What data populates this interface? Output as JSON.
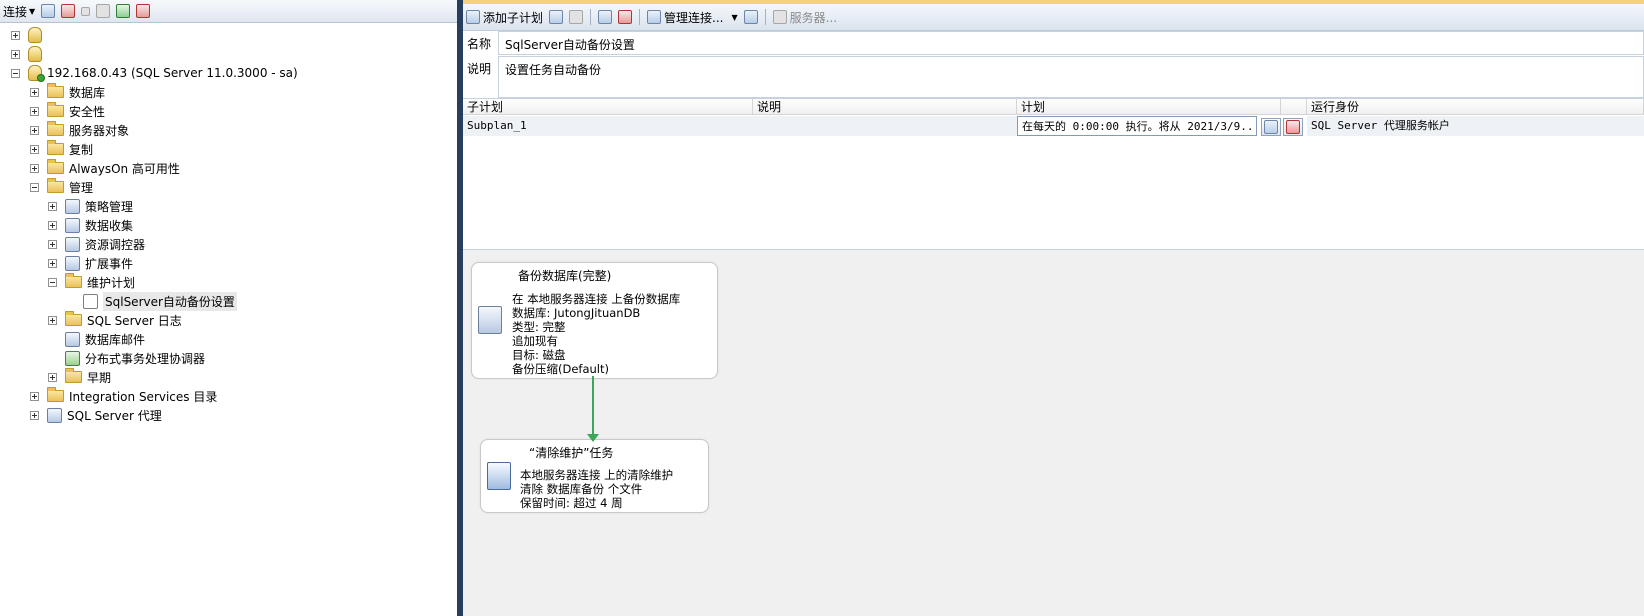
{
  "left_toolbar": {
    "connect_label": "连接",
    "icons": [
      "connect-object-explorer-icon",
      "disconnect-icon",
      "stop-icon",
      "filter-icon",
      "refresh-icon",
      "clear-filter-icon"
    ]
  },
  "tree": {
    "server": "192.168.0.43 (SQL Server 11.0.3000 - sa)",
    "items": [
      {
        "label": "数据库"
      },
      {
        "label": "安全性"
      },
      {
        "label": "服务器对象"
      },
      {
        "label": "复制"
      },
      {
        "label": "AlwaysOn 高可用性"
      },
      {
        "label": "管理"
      },
      {
        "label": "策略管理"
      },
      {
        "label": "数据收集"
      },
      {
        "label": "资源调控器"
      },
      {
        "label": "扩展事件"
      },
      {
        "label": "维护计划"
      },
      {
        "label": "SqlServer自动备份设置"
      },
      {
        "label": "SQL Server 日志"
      },
      {
        "label": "数据库邮件"
      },
      {
        "label": "分布式事务处理协调器"
      },
      {
        "label": "早期"
      },
      {
        "label": "Integration Services 目录"
      },
      {
        "label": "SQL Server 代理"
      }
    ]
  },
  "right_toolbar": {
    "add_subplan": "添加子计划",
    "manage_connections": "管理连接...",
    "servers": "服务器..."
  },
  "plan": {
    "name_label": "名称",
    "name_value": "SqlServer自动备份设置",
    "desc_label": "说明",
    "desc_value": "设置任务自动备份"
  },
  "grid": {
    "headers": [
      "子计划",
      "说明",
      "计划",
      "运行身份"
    ],
    "rows": [
      {
        "subplan": "Subplan_1",
        "description": "",
        "schedule": "在每天的 0:00:00 执行。将从 2021/3/9...",
        "run_as": "SQL Server 代理服务帐户"
      }
    ]
  },
  "tasks": {
    "backup": {
      "title": "备份数据库(完整)",
      "lines": [
        "在 本地服务器连接 上备份数据库",
        "数据库: JutongJituanDB",
        "类型: 完整",
        "追加现有",
        "目标: 磁盘",
        "备份压缩(Default)"
      ]
    },
    "cleanup": {
      "title": "“清除维护”任务",
      "lines": [
        "本地服务器连接 上的清除维护",
        "清除 数据库备份 个文件",
        "保留时间: 超过 4 周"
      ]
    }
  },
  "colors": {
    "connector": "#3aa856",
    "splitter": "#283e5e",
    "top_accent": "#f5d17b"
  }
}
